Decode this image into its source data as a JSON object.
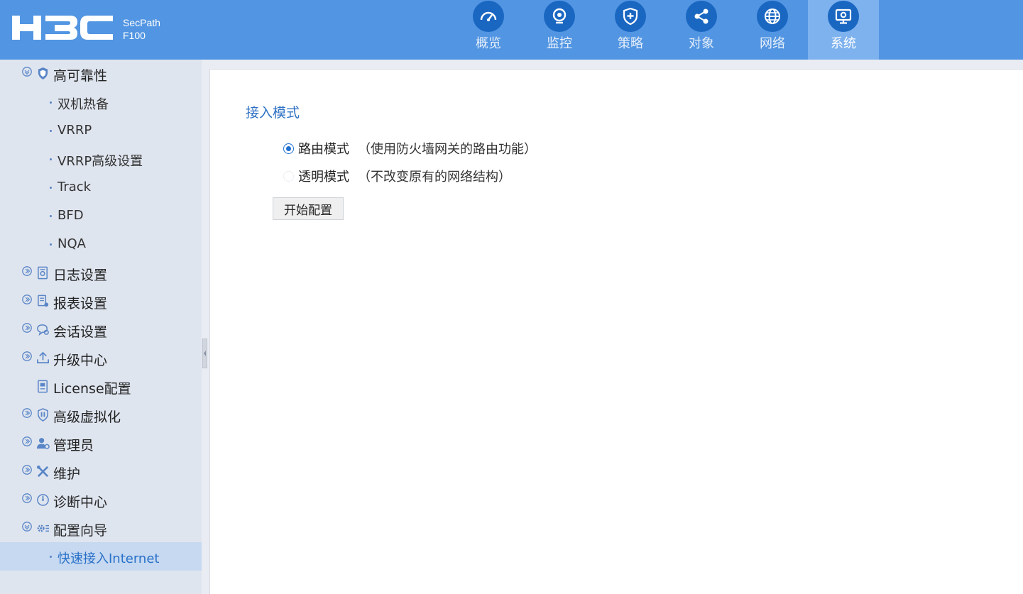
{
  "header": {
    "brand": "H3C",
    "product_line1": "SecPath",
    "product_line2": "F100",
    "nav": [
      {
        "label": "概览",
        "icon": "dashboard-icon"
      },
      {
        "label": "监控",
        "icon": "camera-icon"
      },
      {
        "label": "策略",
        "icon": "shield-plus-icon"
      },
      {
        "label": "对象",
        "icon": "share-icon"
      },
      {
        "label": "网络",
        "icon": "globe-icon"
      },
      {
        "label": "系统",
        "icon": "monitor-gear-icon",
        "active": true
      }
    ]
  },
  "sidebar": {
    "items": [
      {
        "label": "高可靠性",
        "icon": "shield-icon",
        "expanded": true
      },
      {
        "label": "双机热备"
      },
      {
        "label": "VRRP"
      },
      {
        "label": "VRRP高级设置"
      },
      {
        "label": "Track"
      },
      {
        "label": "BFD"
      },
      {
        "label": "NQA"
      },
      {
        "label": "日志设置",
        "icon": "log-settings-icon"
      },
      {
        "label": "报表设置",
        "icon": "report-settings-icon"
      },
      {
        "label": "会话设置",
        "icon": "session-settings-icon"
      },
      {
        "label": "升级中心",
        "icon": "upload-icon"
      },
      {
        "label": "License配置",
        "icon": "license-icon"
      },
      {
        "label": "高级虚拟化",
        "icon": "virtualization-icon"
      },
      {
        "label": "管理员",
        "icon": "admin-icon"
      },
      {
        "label": "维护",
        "icon": "tools-icon"
      },
      {
        "label": "诊断中心",
        "icon": "diagnostic-icon"
      },
      {
        "label": "配置向导",
        "icon": "wizard-gear-icon",
        "expanded": true
      },
      {
        "label": "快速接入Internet",
        "selected": true
      }
    ]
  },
  "main": {
    "section_title": "接入模式",
    "options": [
      {
        "label": "路由模式",
        "desc": "（使用防火墙网关的路由功能）",
        "checked": true
      },
      {
        "label": "透明模式",
        "desc": "（不改变原有的网络结构）",
        "checked": false
      }
    ],
    "start_button": "开始配置"
  },
  "colors": {
    "header_bg": "#5295e2",
    "nav_active_bg": "#7eb2ee",
    "accent": "#2f72c4",
    "sidebar_bg": "#dfe5ef",
    "sidebar_selected_bg": "#c6d9f1"
  }
}
